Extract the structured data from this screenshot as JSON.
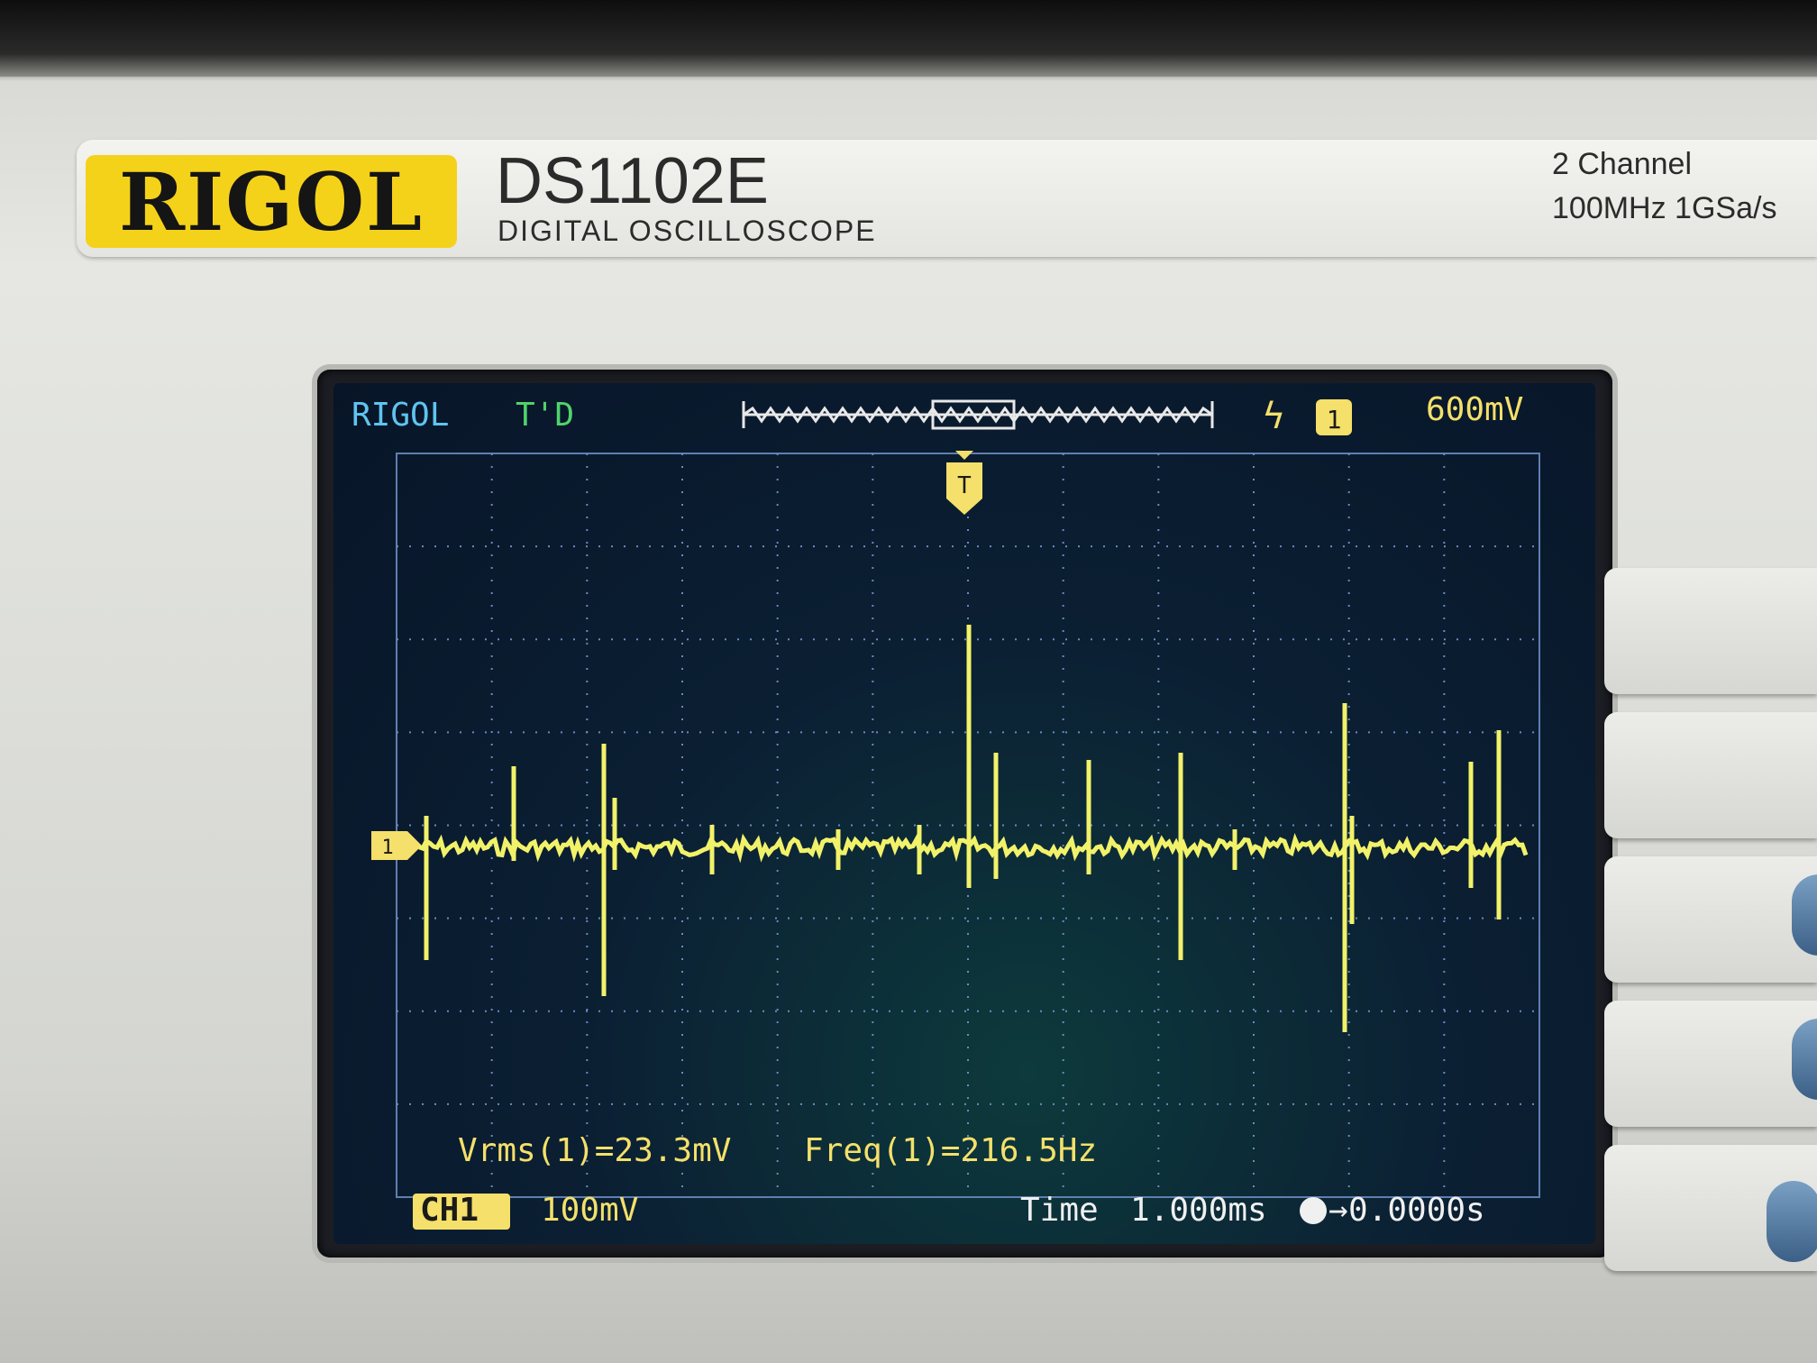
{
  "panel": {
    "brand": "RIGOL",
    "model": "DS1102E",
    "subtitle": "DIGITAL OSCILLOSCOPE",
    "spec_line1": "2 Channel",
    "spec_line2": "100MHz 1GSa/s"
  },
  "display": {
    "brand": "RIGOL",
    "status": "T'D",
    "trigger_level": "600mV",
    "trigger_channel": "1",
    "trigger_marker": "T",
    "channel_marker": "1",
    "measure_vrms": "Vrms(1)=23.3mV",
    "measure_freq": "Freq(1)=216.5Hz",
    "ch1_label": "CH1",
    "ch1_scale": "100mV",
    "time_label": "Time",
    "time_scale": "1.000ms",
    "trigger_offset": "0.0000s"
  },
  "colors": {
    "trace": "#f2f26a",
    "grid": "#5f7fb0",
    "accent_blue": "#5fc4f0",
    "accent_green": "#4fd46a",
    "accent_yellow": "#f4e06a",
    "logo_yellow": "#f5d21a"
  }
}
